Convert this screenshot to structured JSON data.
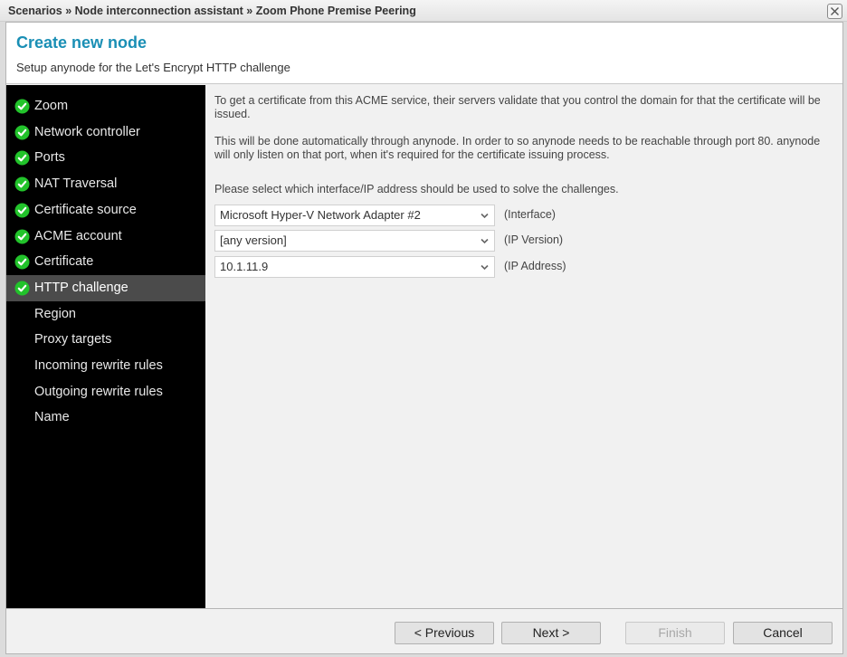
{
  "window": {
    "breadcrumb": "Scenarios » Node interconnection assistant » Zoom Phone Premise Peering",
    "close_icon": "close-x-icon"
  },
  "header": {
    "title": "Create new node",
    "subtitle": "Setup anynode for the Let's Encrypt HTTP challenge"
  },
  "colors": {
    "title": "#1a8fb5",
    "check_green": "#22c32b",
    "sidebar_bg": "#000000",
    "sidebar_active": "#4b4b4b"
  },
  "sidebar": {
    "items": [
      {
        "label": "Zoom",
        "done": true,
        "active": false
      },
      {
        "label": "Network controller",
        "done": true,
        "active": false
      },
      {
        "label": "Ports",
        "done": true,
        "active": false
      },
      {
        "label": "NAT Traversal",
        "done": true,
        "active": false
      },
      {
        "label": "Certificate source",
        "done": true,
        "active": false
      },
      {
        "label": "ACME account",
        "done": true,
        "active": false
      },
      {
        "label": "Certificate",
        "done": true,
        "active": false
      },
      {
        "label": "HTTP challenge",
        "done": true,
        "active": true
      },
      {
        "label": "Region",
        "done": false,
        "active": false
      },
      {
        "label": "Proxy targets",
        "done": false,
        "active": false
      },
      {
        "label": "Incoming rewrite rules",
        "done": false,
        "active": false
      },
      {
        "label": "Outgoing rewrite rules",
        "done": false,
        "active": false
      },
      {
        "label": "Name",
        "done": false,
        "active": false
      }
    ]
  },
  "content": {
    "paragraphs": [
      "To get a certificate from this ACME service, their servers validate that you control the domain for that the certificate will be issued.",
      "This will be done automatically through anynode. In order to so anynode needs to be reachable through port 80. anynode will only listen on that port, when it's required for the certificate issuing process.",
      "Please select which interface/IP address should be used to solve the challenges."
    ],
    "selects": [
      {
        "value": "Microsoft Hyper-V Network Adapter #2",
        "hint": "(Interface)"
      },
      {
        "value": "[any version]",
        "hint": "(IP Version)"
      },
      {
        "value": "10.1.11.9",
        "hint": "(IP Address)"
      }
    ]
  },
  "footer": {
    "previous_label": "< Previous",
    "next_label": "Next >",
    "finish_label": "Finish",
    "finish_disabled": true,
    "cancel_label": "Cancel"
  }
}
